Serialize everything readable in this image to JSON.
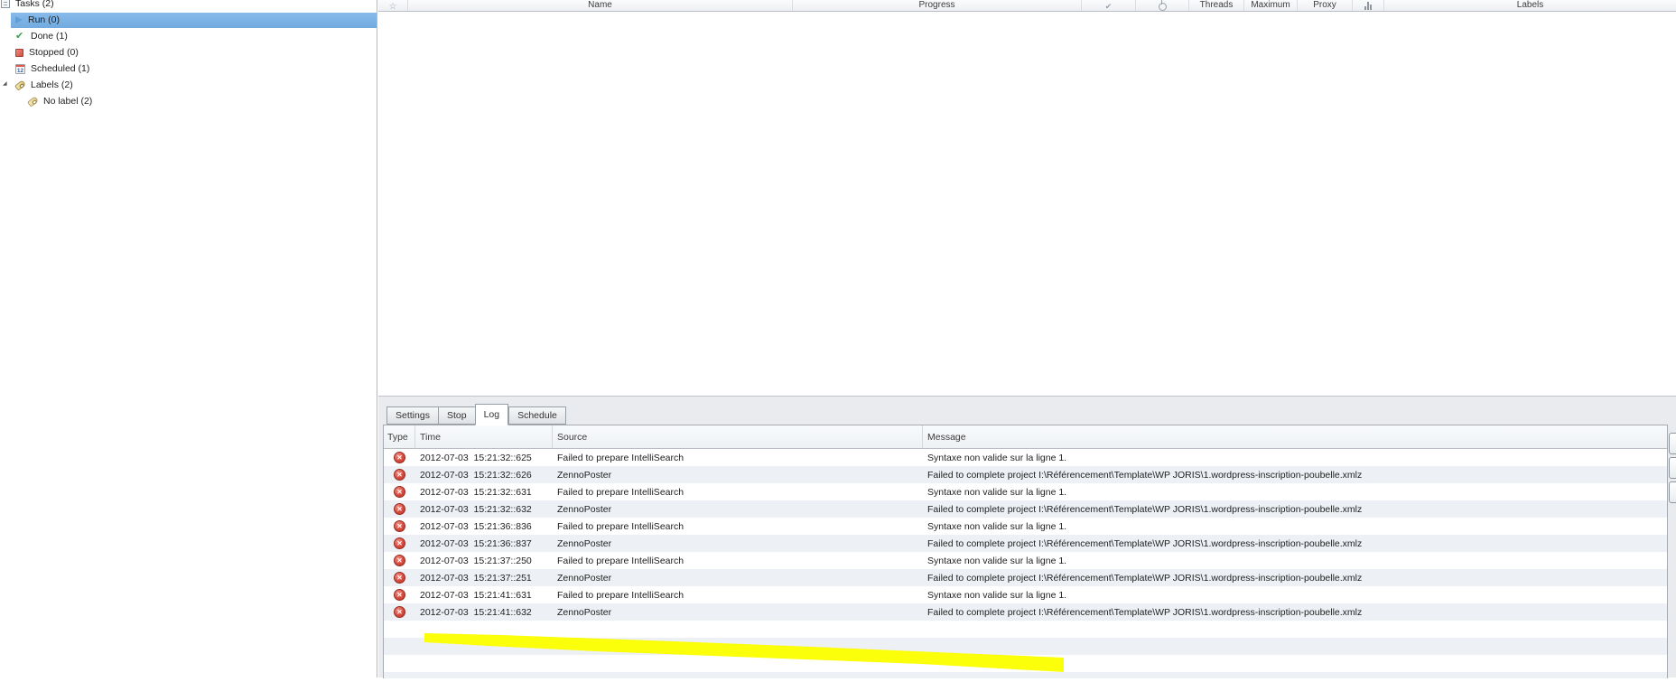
{
  "sidebar": {
    "root_label": "Tasks (2)",
    "items": [
      {
        "label": "Run (0)",
        "icon": "run-icon",
        "level": 1,
        "selected": true
      },
      {
        "label": "Done (1)",
        "icon": "done-icon",
        "level": 1
      },
      {
        "label": "Stopped (0)",
        "icon": "stopped-icon",
        "level": 1
      },
      {
        "label": "Scheduled (1)",
        "icon": "scheduled-icon",
        "level": 1
      },
      {
        "label": "Labels (2)",
        "icon": "labels-icon",
        "level": 1,
        "expanded": true
      },
      {
        "label": "No label (2)",
        "icon": "label-icon",
        "level": 2
      }
    ]
  },
  "task_grid": {
    "columns": [
      {
        "id": "favorite",
        "icon": "star-icon"
      },
      {
        "id": "name",
        "label": "Name"
      },
      {
        "id": "progress",
        "label": "Progress"
      },
      {
        "id": "completed",
        "icon": "check-icon"
      },
      {
        "id": "power",
        "icon": "power-icon"
      },
      {
        "id": "threads",
        "label": "Threads"
      },
      {
        "id": "maximum",
        "label": "Maximum"
      },
      {
        "id": "proxy",
        "label": "Proxy"
      },
      {
        "id": "stats",
        "icon": "chart-icon"
      },
      {
        "id": "labels",
        "label": "Labels"
      }
    ]
  },
  "bottom_panel": {
    "tabs": [
      {
        "label": "Settings"
      },
      {
        "label": "Stop"
      },
      {
        "label": "Log",
        "active": true
      },
      {
        "label": "Schedule"
      }
    ],
    "side_button_count": 3,
    "log": {
      "columns": [
        "Type",
        "Time",
        "Source",
        "Message"
      ],
      "rows": [
        {
          "type": "error",
          "time": "2012-07-03  15:21:32::625",
          "source": "Failed to prepare IntelliSearch",
          "message": "Syntaxe non valide sur la ligne 1."
        },
        {
          "type": "error",
          "time": "2012-07-03  15:21:32::626",
          "source": "ZennoPoster",
          "message": "Failed to complete project I:\\Référencement\\Template\\WP JORIS\\1.wordpress-inscription-poubelle.xmlz"
        },
        {
          "type": "error",
          "time": "2012-07-03  15:21:32::631",
          "source": "Failed to prepare IntelliSearch",
          "message": "Syntaxe non valide sur la ligne 1."
        },
        {
          "type": "error",
          "time": "2012-07-03  15:21:32::632",
          "source": "ZennoPoster",
          "message": "Failed to complete project I:\\Référencement\\Template\\WP JORIS\\1.wordpress-inscription-poubelle.xmlz"
        },
        {
          "type": "error",
          "time": "2012-07-03  15:21:36::836",
          "source": "Failed to prepare IntelliSearch",
          "message": "Syntaxe non valide sur la ligne 1."
        },
        {
          "type": "error",
          "time": "2012-07-03  15:21:36::837",
          "source": "ZennoPoster",
          "message": "Failed to complete project I:\\Référencement\\Template\\WP JORIS\\1.wordpress-inscription-poubelle.xmlz"
        },
        {
          "type": "error",
          "time": "2012-07-03  15:21:37::250",
          "source": "Failed to prepare IntelliSearch",
          "message": "Syntaxe non valide sur la ligne 1."
        },
        {
          "type": "error",
          "time": "2012-07-03  15:21:37::251",
          "source": "ZennoPoster",
          "message": "Failed to complete project I:\\Référencement\\Template\\WP JORIS\\1.wordpress-inscription-poubelle.xmlz"
        },
        {
          "type": "error",
          "time": "2012-07-03  15:21:41::631",
          "source": "Failed to prepare IntelliSearch",
          "message": "Syntaxe non valide sur la ligne 1."
        },
        {
          "type": "error",
          "time": "2012-07-03  15:21:41::632",
          "source": "ZennoPoster",
          "message": "Failed to complete project I:\\Référencement\\Template\\WP JORIS\\1.wordpress-inscription-poubelle.xmlz"
        }
      ]
    }
  },
  "annotation": {
    "highlighter_color": "#fcff00"
  },
  "colors": {
    "selection_blue": "#72abe0",
    "row_stripe": "#edf1f6",
    "error_red": "#d8493d"
  }
}
